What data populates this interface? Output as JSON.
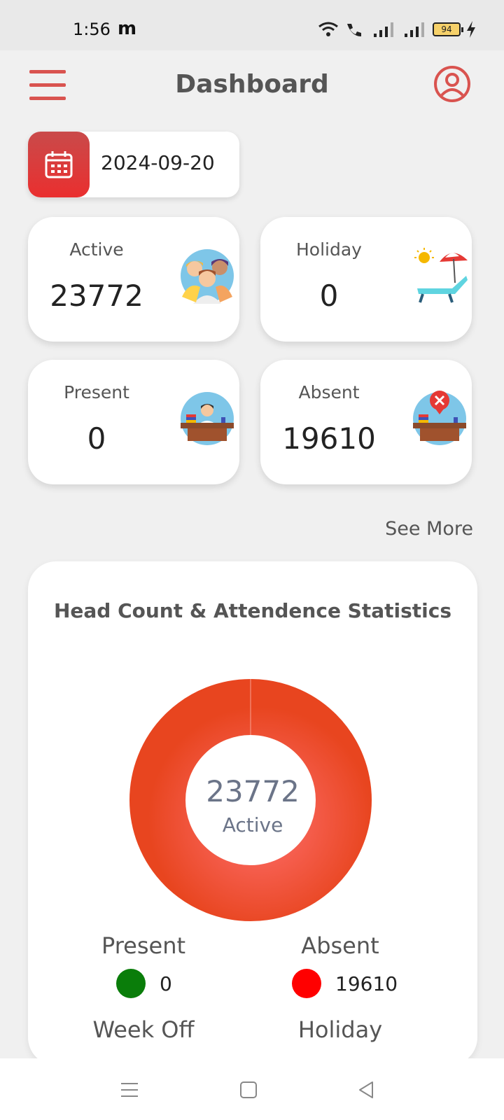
{
  "status_bar": {
    "time": "1:56",
    "app_letter": "m",
    "battery": "94"
  },
  "header": {
    "title": "Dashboard",
    "menu_icon": "hamburger-menu-icon",
    "profile_icon": "user-profile-icon"
  },
  "date_filter": {
    "value": "2024-09-20",
    "icon": "calendar-icon"
  },
  "stats": [
    {
      "label": "Active",
      "value": "23772",
      "icon": "people-group-icon"
    },
    {
      "label": "Holiday",
      "value": "0",
      "icon": "beach-chair-icon"
    },
    {
      "label": "Present",
      "value": "0",
      "icon": "employee-desk-icon"
    },
    {
      "label": "Absent",
      "value": "19610",
      "icon": "absent-desk-icon"
    }
  ],
  "see_more": "See More",
  "chart": {
    "title": "Head Count & Attendence Statistics",
    "center_value": "23772",
    "center_label": "Active",
    "legend": [
      {
        "label": "Present",
        "value": "0",
        "color": "#0a7d0a"
      },
      {
        "label": "Absent",
        "value": "19610",
        "color": "#ff0000"
      },
      {
        "label": "Week Off",
        "value": ""
      },
      {
        "label": "Holiday",
        "value": ""
      }
    ]
  },
  "chart_data": {
    "type": "pie",
    "categories": [
      "Present",
      "Absent",
      "Week Off",
      "Holiday"
    ],
    "values": [
      0,
      19610,
      null,
      0
    ],
    "title": "Head Count & Attendence Statistics",
    "center_text": "23772 Active",
    "colors": {
      "ring": "#ea4a2f",
      "present": "#0a7d0a",
      "absent": "#ff0000"
    }
  },
  "colors": {
    "accent": "#d9534f",
    "background": "#f0f0f0"
  }
}
